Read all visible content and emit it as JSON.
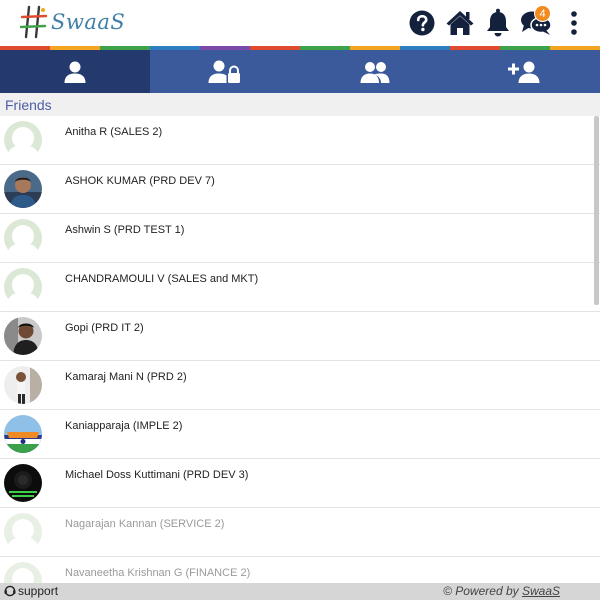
{
  "app": {
    "logo_text": "SwaaS",
    "notifications_badge": "4"
  },
  "header_icons": [
    "help-icon",
    "home-icon",
    "bell-icon",
    "chat-icon",
    "more-vertical-icon"
  ],
  "colors": {
    "tab_bar": "#3b5a9b",
    "tab_active": "#243a6e",
    "section_text": "#4e5fa8",
    "badge": "#f28a1f",
    "stripe": [
      "#e04a2f",
      "#f3a51f",
      "#3ea24b",
      "#2e7fc1",
      "#7a4aa8",
      "#e04a2f",
      "#3ea24b",
      "#f3a51f",
      "#2e7fc1",
      "#e04a2f",
      "#3ea24b",
      "#f3a51f"
    ]
  },
  "tabs": [
    {
      "icon": "user-icon",
      "active": true
    },
    {
      "icon": "user-lock-icon",
      "active": false
    },
    {
      "icon": "users-icon",
      "active": false
    },
    {
      "icon": "user-plus-icon",
      "active": false
    }
  ],
  "section": {
    "title": "Friends"
  },
  "friends": [
    {
      "name": "Anitha R (SALES 2)",
      "avatar": "placeholder",
      "faded": false
    },
    {
      "name": "ASHOK KUMAR (PRD DEV 7)",
      "avatar": "photo",
      "faded": false
    },
    {
      "name": "Ashwin S (PRD TEST 1)",
      "avatar": "placeholder",
      "faded": false
    },
    {
      "name": "CHANDRAMOULI V (SALES and MKT)",
      "avatar": "placeholder",
      "faded": false
    },
    {
      "name": "Gopi (PRD IT 2)",
      "avatar": "photo",
      "faded": false
    },
    {
      "name": "Kamaraj Mani N (PRD 2)",
      "avatar": "photo",
      "faded": false
    },
    {
      "name": "Kaniapparaja (IMPLE 2)",
      "avatar": "photo",
      "faded": false
    },
    {
      "name": "Michael Doss Kuttimani (PRD DEV 3)",
      "avatar": "photo",
      "faded": false
    },
    {
      "name": "Nagarajan Kannan (SERVICE 2)",
      "avatar": "placeholder",
      "faded": true
    },
    {
      "name": "Navaneetha Krishnan G (FINANCE 2)",
      "avatar": "placeholder",
      "faded": true
    }
  ],
  "footer": {
    "support_label": "support",
    "powered_prefix": "© Powered by ",
    "powered_brand": "SwaaS"
  }
}
